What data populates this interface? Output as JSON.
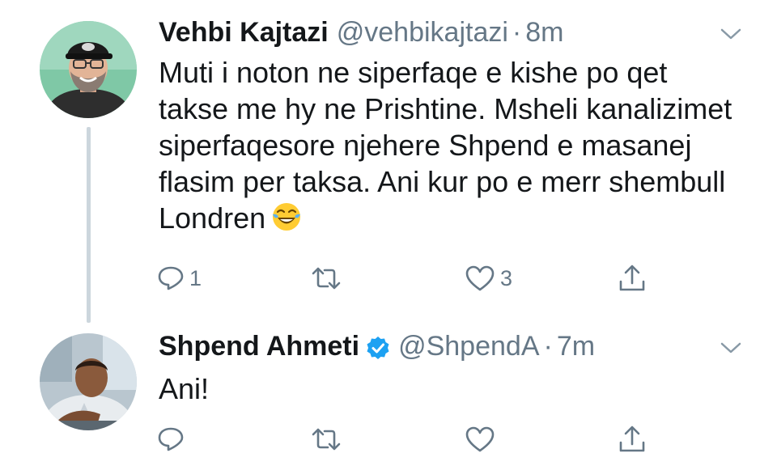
{
  "tweets": [
    {
      "name": "Vehbi Kajtazi",
      "handle": "@vehbikajtazi",
      "separator": "·",
      "time": "8m",
      "verified": false,
      "text": "Muti i noton ne siperfaqe e kishe po qet takse me hy ne Prishtine. Msheli kanalizimet siperfaqesore njehere Shpend e masanej flasim per taksa. Ani kur po e merr shembull Londren",
      "emoji": "face-with-tears-of-joy",
      "reply_count": "1",
      "retweet_count": "",
      "like_count": "3",
      "avatar_icon": "avatar-man-with-cap-and-glasses"
    },
    {
      "name": "Shpend Ahmeti",
      "handle": "@ShpendA",
      "separator": "·",
      "time": "7m",
      "verified": true,
      "text": "Ani!",
      "reply_count": "",
      "retweet_count": "",
      "like_count": "",
      "avatar_icon": "avatar-man-at-desk"
    }
  ],
  "icons": {
    "reply": "reply-icon",
    "retweet": "retweet-icon",
    "like": "like-icon",
    "share": "share-icon",
    "caret": "chevron-down-icon",
    "verified": "verified-badge-icon"
  },
  "colors": {
    "text": "#14171a",
    "secondary": "#657786",
    "verified_blue": "#1da1f2",
    "thread_line": "#ccd6dd"
  }
}
